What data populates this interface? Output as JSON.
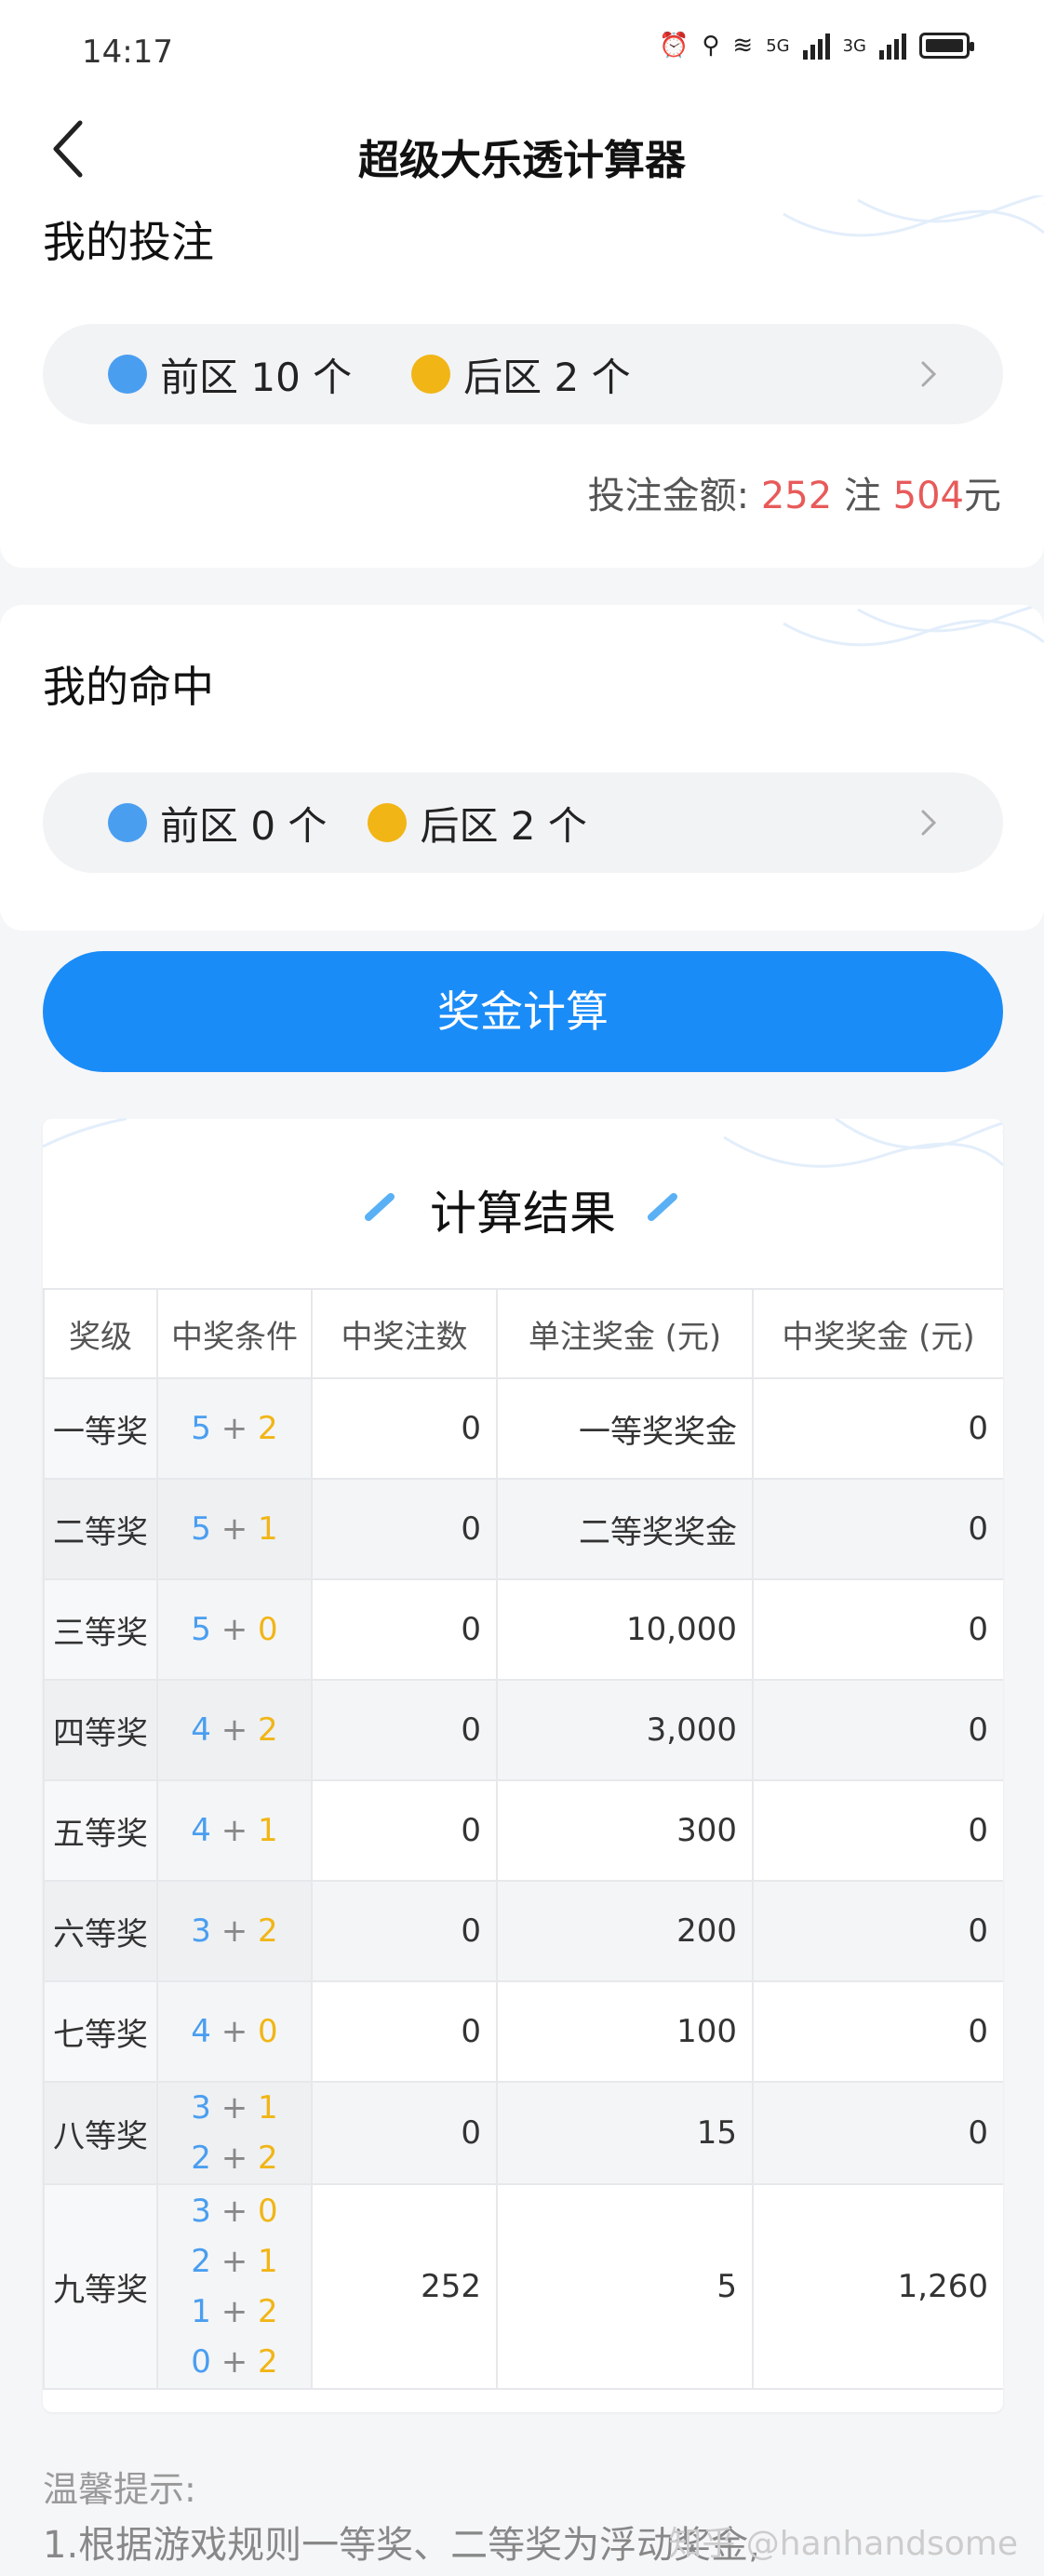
{
  "status": {
    "time": "14:17",
    "net1": "5G",
    "net2": "3G"
  },
  "nav": {
    "title": "超级大乐透计算器"
  },
  "bet": {
    "title": "我的投注",
    "front": "前区 10 个",
    "back": "后区 2 个",
    "amount_label": "投注金额:",
    "count": "252",
    "count_unit": "注",
    "money": "504",
    "money_unit": "元"
  },
  "hit": {
    "title": "我的命中",
    "front": "前区 0 个",
    "back": "后区 2 个"
  },
  "calc_button": "奖金计算",
  "result": {
    "title": "计算结果",
    "headers": [
      "奖级",
      "中奖条件",
      "中奖注数",
      "单注奖金 (元)",
      "中奖奖金 (元)"
    ],
    "rows": [
      {
        "level": "一等奖",
        "conds": [
          [
            "5",
            "2"
          ]
        ],
        "count": "0",
        "single": "一等奖奖金",
        "total": "0"
      },
      {
        "level": "二等奖",
        "conds": [
          [
            "5",
            "1"
          ]
        ],
        "count": "0",
        "single": "二等奖奖金",
        "total": "0"
      },
      {
        "level": "三等奖",
        "conds": [
          [
            "5",
            "0"
          ]
        ],
        "count": "0",
        "single": "10,000",
        "total": "0"
      },
      {
        "level": "四等奖",
        "conds": [
          [
            "4",
            "2"
          ]
        ],
        "count": "0",
        "single": "3,000",
        "total": "0"
      },
      {
        "level": "五等奖",
        "conds": [
          [
            "4",
            "1"
          ]
        ],
        "count": "0",
        "single": "300",
        "total": "0"
      },
      {
        "level": "六等奖",
        "conds": [
          [
            "3",
            "2"
          ]
        ],
        "count": "0",
        "single": "200",
        "total": "0"
      },
      {
        "level": "七等奖",
        "conds": [
          [
            "4",
            "0"
          ]
        ],
        "count": "0",
        "single": "100",
        "total": "0"
      },
      {
        "level": "八等奖",
        "conds": [
          [
            "3",
            "1"
          ],
          [
            "2",
            "2"
          ]
        ],
        "count": "0",
        "single": "15",
        "total": "0"
      },
      {
        "level": "九等奖",
        "conds": [
          [
            "3",
            "0"
          ],
          [
            "2",
            "1"
          ],
          [
            "1",
            "2"
          ],
          [
            "0",
            "2"
          ]
        ],
        "count": "252",
        "single": "5",
        "total": "1,260"
      }
    ]
  },
  "tips": {
    "title": "温馨提示:",
    "line1": "1.根据游戏规则一等奖、二等奖为浮动奖金,"
  },
  "watermark": "知乎 @hanhandsome",
  "colors": {
    "primary": "#1a8cf7",
    "front_ball": "#4a9ef0",
    "back_ball": "#f1b516",
    "highlight": "#e85a5a"
  }
}
